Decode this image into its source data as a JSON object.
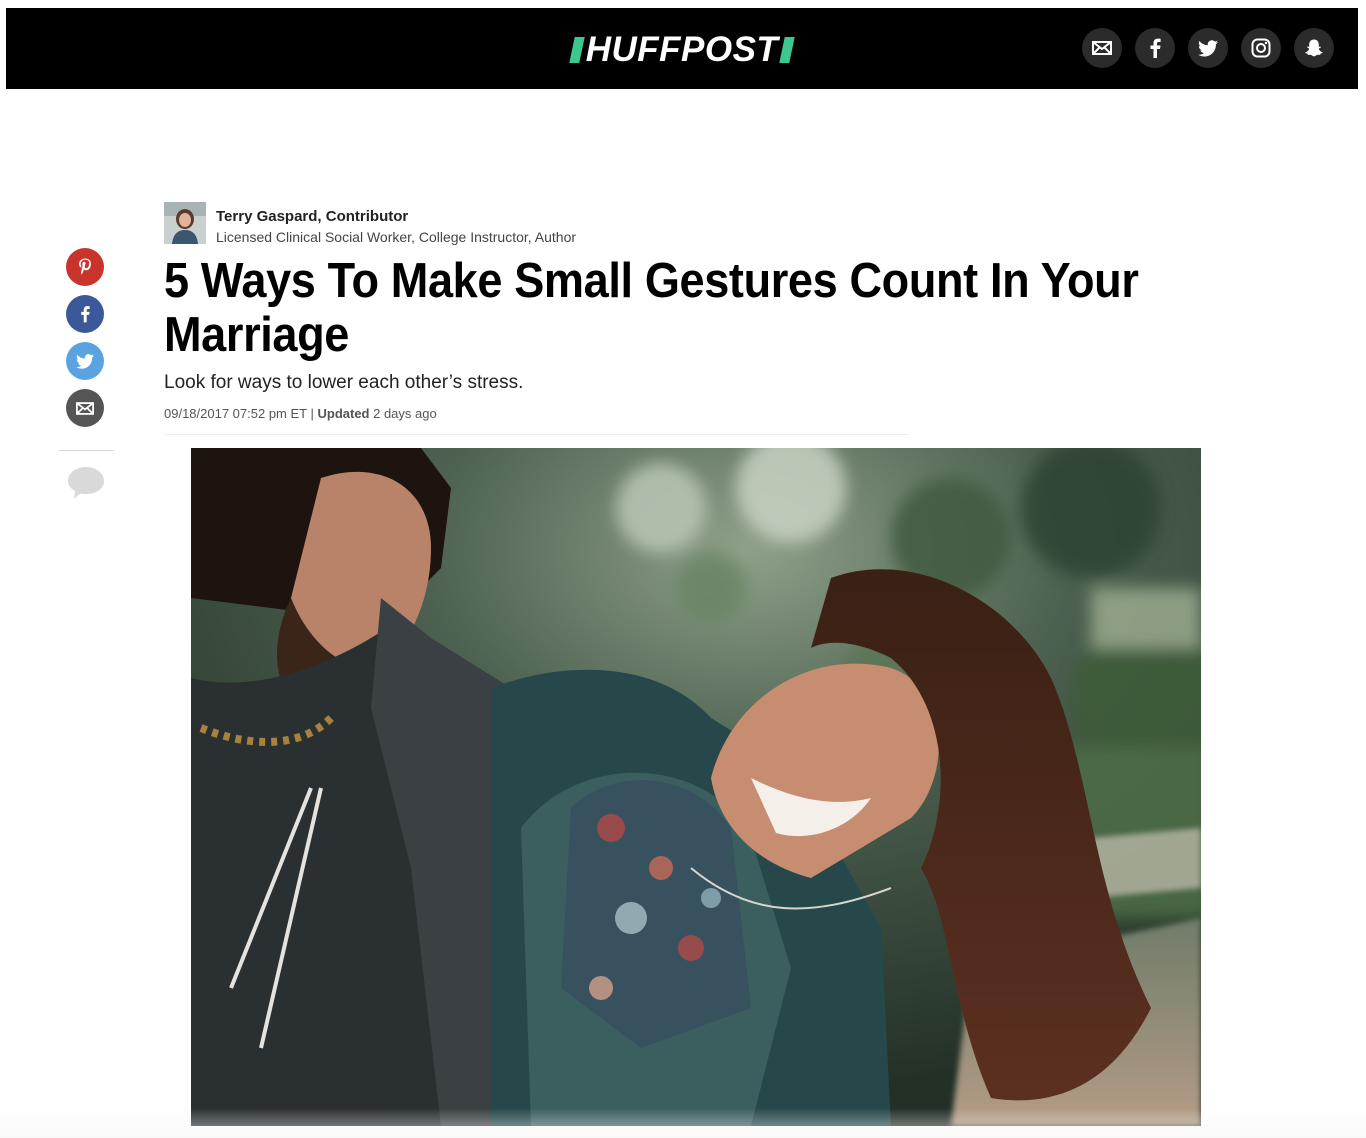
{
  "header": {
    "logo_text": "HUFFPOST",
    "brand_accent": "#3ec68f",
    "background": "#000000",
    "social": [
      {
        "name": "email-icon",
        "label": "Email"
      },
      {
        "name": "facebook-icon",
        "label": "Facebook"
      },
      {
        "name": "twitter-icon",
        "label": "Twitter"
      },
      {
        "name": "instagram-icon",
        "label": "Instagram"
      },
      {
        "name": "snapchat-icon",
        "label": "Snapchat"
      }
    ]
  },
  "share_rail": {
    "buttons": [
      {
        "icon": "pinterest-icon",
        "color": "#c8342b"
      },
      {
        "icon": "facebook-icon",
        "color": "#3b5998"
      },
      {
        "icon": "twitter-icon",
        "color": "#5aa3e0"
      },
      {
        "icon": "email-icon",
        "color": "#555555"
      }
    ],
    "comments_icon": "comment-icon"
  },
  "article": {
    "author": {
      "name": "Terry Gaspard, Contributor",
      "bio": "Licensed Clinical Social Worker, College Instructor, Author"
    },
    "headline": "5 Ways To Make Small Gestures Count In Your Marriage",
    "dek": "Look for ways to lower each other’s stress.",
    "published": "09/18/2017 07:52 pm ET",
    "separator": " | ",
    "updated_label": "Updated",
    "updated_value": " 2 days ago"
  }
}
